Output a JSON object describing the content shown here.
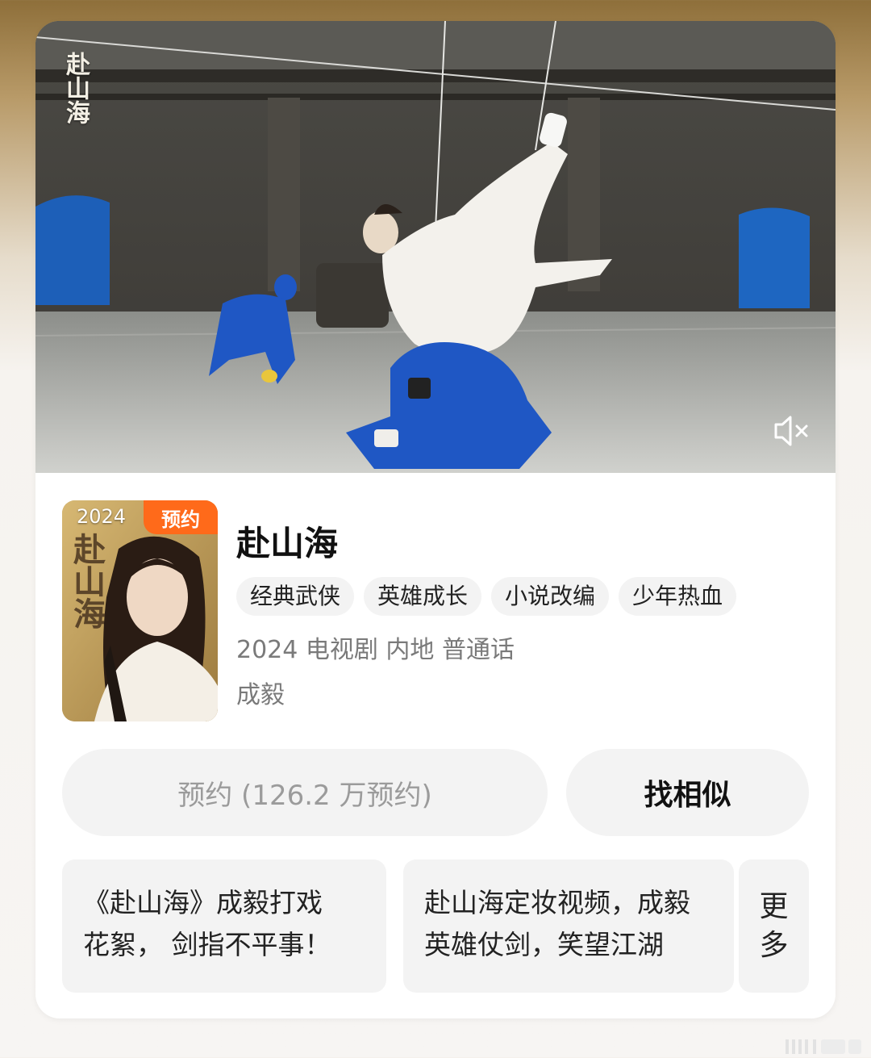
{
  "video": {
    "logo_text": "赴山海",
    "mute_icon": "speaker-muted-icon"
  },
  "poster": {
    "year": "2024",
    "badge": "预约",
    "title_art": "赴山海"
  },
  "show": {
    "title": "赴山海",
    "tags": [
      "经典武侠",
      "英雄成长",
      "小说改编",
      "少年热血"
    ],
    "meta": "2024 电视剧 内地 普通话",
    "actor": "成毅"
  },
  "actions": {
    "reserve_label": "预约 (126.2 万预约)",
    "similar_label": "找相似"
  },
  "related": {
    "item1_line1": "《赴山海》成毅打戏",
    "item1_line2": "花絮， 剑指不平事！",
    "item2_text": "赴山海定妆视频，成毅英雄仗剑，笑望江湖",
    "more_line1": "更",
    "more_line2": "多"
  },
  "colors": {
    "accent_orange": "#ff6a1a",
    "chip_bg": "#f3f3f3",
    "muted_text": "#7a7a7a",
    "blue_suit": "#1f57c4"
  }
}
